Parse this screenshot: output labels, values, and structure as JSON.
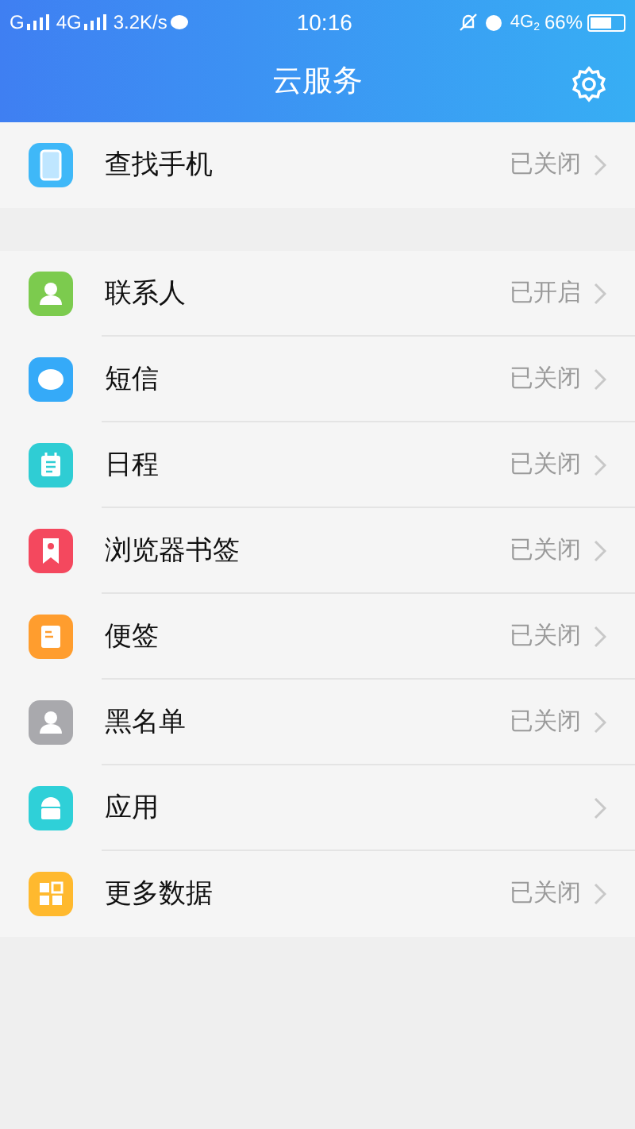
{
  "status_bar": {
    "sim1": "G",
    "sim2": "4G",
    "speed": "3.2K/s",
    "time": "10:16",
    "network": "4G",
    "network_sub": "2",
    "battery": "66%"
  },
  "header": {
    "title": "云服务"
  },
  "sections": [
    {
      "items": [
        {
          "label": "查找手机",
          "status": "已关闭",
          "kind": "phone",
          "color": "#3fb8f8"
        }
      ]
    },
    {
      "items": [
        {
          "label": "联系人",
          "status": "已开启",
          "kind": "person",
          "color": "#7ccb4e"
        },
        {
          "label": "短信",
          "status": "已关闭",
          "kind": "message",
          "color": "#35aaf8"
        },
        {
          "label": "日程",
          "status": "已关闭",
          "kind": "calendar",
          "color": "#2fcdd4"
        },
        {
          "label": "浏览器书签",
          "status": "已关闭",
          "kind": "bookmark",
          "color": "#f4485e"
        },
        {
          "label": "便签",
          "status": "已关闭",
          "kind": "note",
          "color": "#ff9d2e"
        },
        {
          "label": "黑名单",
          "status": "已关闭",
          "kind": "person",
          "color": "#a9a9ad"
        },
        {
          "label": "应用",
          "kind": "android",
          "color": "#2fd0d8"
        },
        {
          "label": "更多数据",
          "status": "已关闭",
          "kind": "grid",
          "color": "#ffb92e"
        }
      ]
    }
  ]
}
